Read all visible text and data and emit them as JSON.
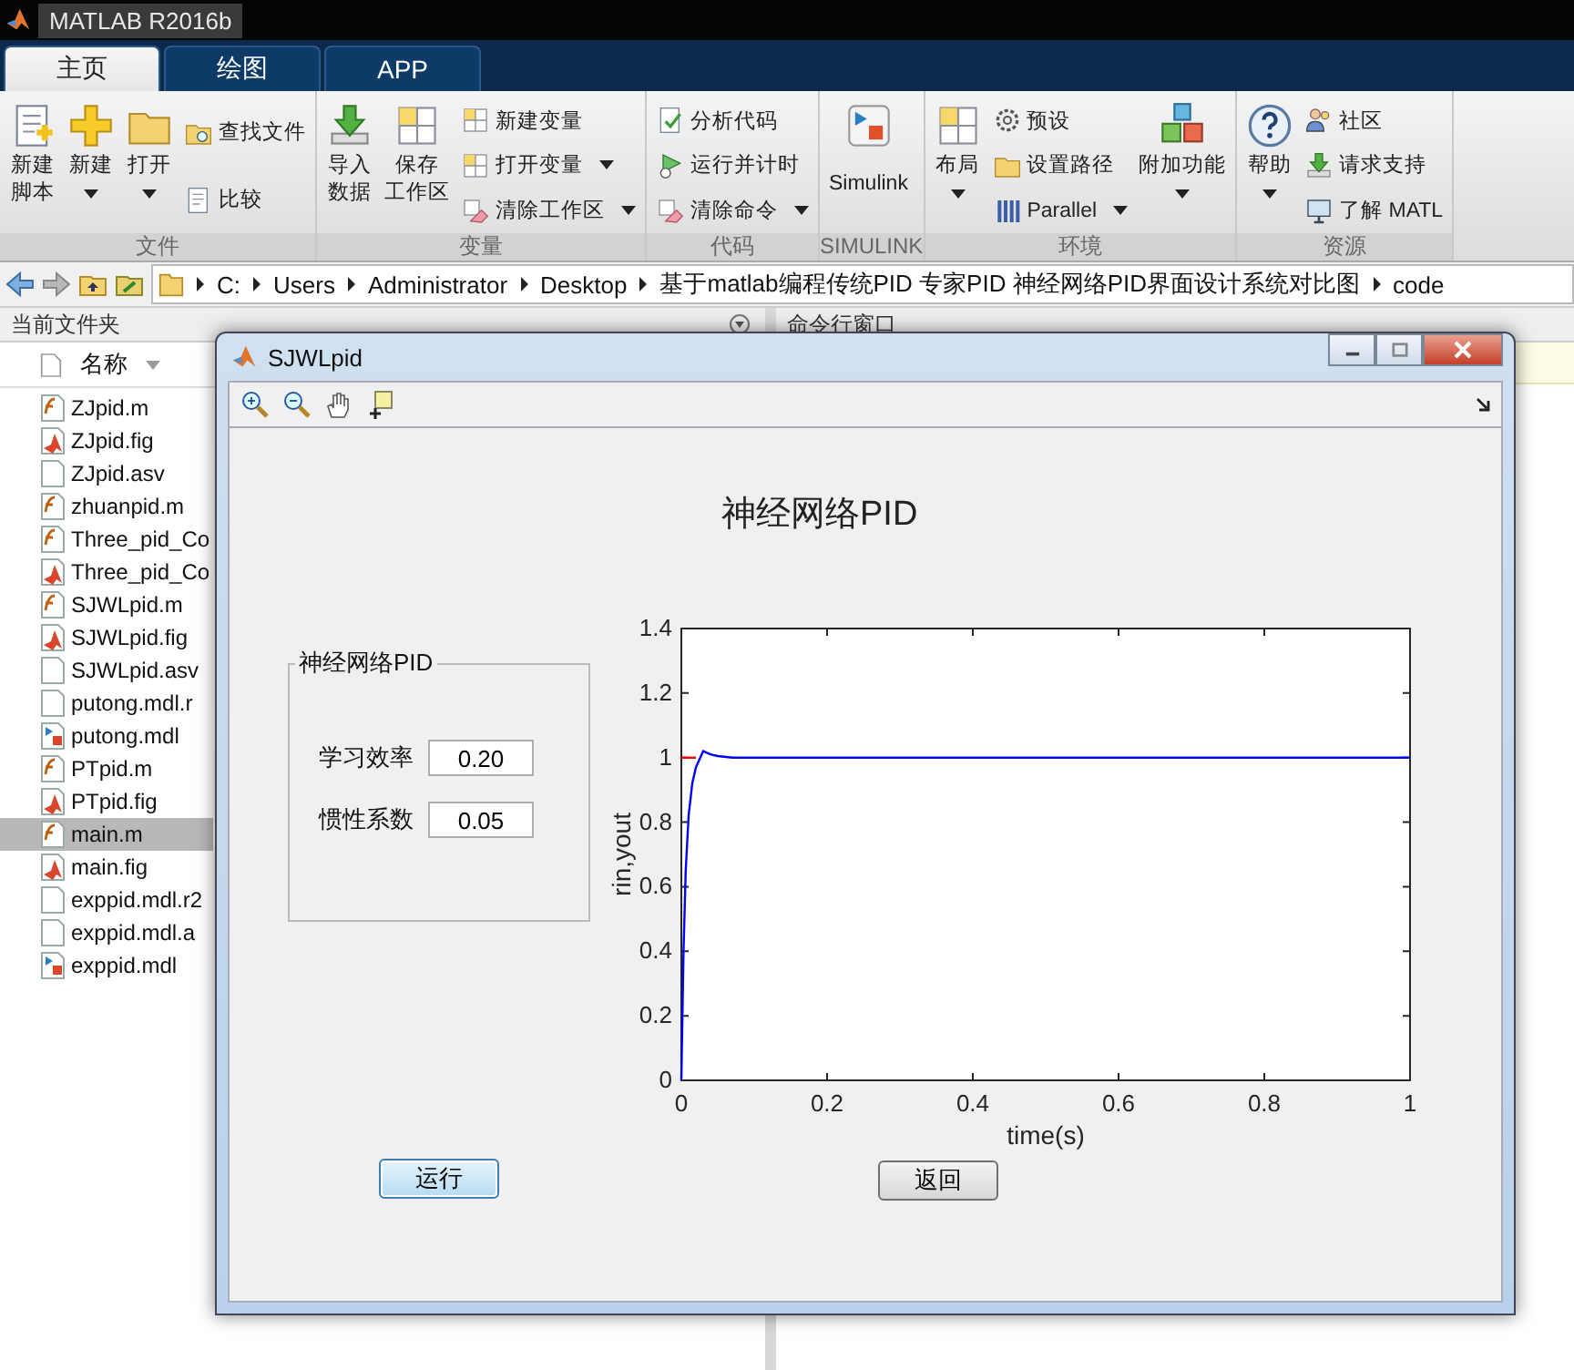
{
  "title_bar": {
    "title": "MATLAB R2016b"
  },
  "tabs": [
    {
      "label": "主页",
      "selected": true
    },
    {
      "label": "绘图",
      "selected": false
    },
    {
      "label": "APP",
      "selected": false
    }
  ],
  "ribbon": [
    {
      "label": "文件",
      "items": [
        {
          "kind": "large",
          "lines": [
            "新建",
            "脚本"
          ],
          "dropdown": false
        },
        {
          "kind": "large",
          "lines": [
            "新建"
          ],
          "dropdown": true
        },
        {
          "kind": "large",
          "lines": [
            "打开"
          ],
          "dropdown": true
        },
        {
          "kind": "stack",
          "items": [
            {
              "label": "查找文件",
              "dropdown": false
            },
            {
              "label": "比较",
              "dropdown": false
            }
          ]
        }
      ]
    },
    {
      "label": "变量",
      "items": [
        {
          "kind": "large",
          "lines": [
            "导入",
            "数据"
          ],
          "dropdown": false
        },
        {
          "kind": "large",
          "lines": [
            "保存",
            "工作区"
          ],
          "dropdown": false
        },
        {
          "kind": "stack",
          "items": [
            {
              "label": "新建变量",
              "dropdown": false
            },
            {
              "label": "打开变量",
              "dropdown": true
            },
            {
              "label": "清除工作区",
              "dropdown": true
            }
          ]
        }
      ]
    },
    {
      "label": "代码",
      "items": [
        {
          "kind": "stack",
          "items": [
            {
              "label": "分析代码",
              "dropdown": false
            },
            {
              "label": "运行并计时",
              "dropdown": false
            },
            {
              "label": "清除命令",
              "dropdown": true
            }
          ]
        }
      ]
    },
    {
      "label": "SIMULINK",
      "items": [
        {
          "kind": "large",
          "lines": [
            "Simulink"
          ],
          "dropdown": false
        }
      ]
    },
    {
      "label": "环境",
      "items": [
        {
          "kind": "large",
          "lines": [
            "布局"
          ],
          "dropdown": true
        },
        {
          "kind": "stack",
          "items": [
            {
              "label": "预设",
              "dropdown": false
            },
            {
              "label": "设置路径",
              "dropdown": false
            },
            {
              "label": "Parallel",
              "dropdown": true
            }
          ]
        },
        {
          "kind": "large",
          "lines": [
            "附加功能"
          ],
          "dropdown": true
        }
      ]
    },
    {
      "label": "资源",
      "items": [
        {
          "kind": "large",
          "lines": [
            "帮助"
          ],
          "dropdown": true
        },
        {
          "kind": "stack",
          "items": [
            {
              "label": "社区",
              "dropdown": false
            },
            {
              "label": "请求支持",
              "dropdown": false
            },
            {
              "label": "了解 MATL",
              "dropdown": false
            }
          ]
        }
      ]
    }
  ],
  "address_bar": {
    "path": [
      "C:",
      "Users",
      "Administrator",
      "Desktop",
      "基于matlab编程传统PID 专家PID 神经网络PID界面设计系统对比图",
      "code"
    ]
  },
  "current_folder": {
    "title": "当前文件夹",
    "column": "名称",
    "files": [
      {
        "name": "ZJpid.m",
        "kind": "m",
        "selected": false
      },
      {
        "name": "ZJpid.fig",
        "kind": "fig",
        "selected": false
      },
      {
        "name": "ZJpid.asv",
        "kind": "plain",
        "selected": false
      },
      {
        "name": "zhuanpid.m",
        "kind": "m",
        "selected": false
      },
      {
        "name": "Three_pid_Co",
        "kind": "m",
        "selected": false
      },
      {
        "name": "Three_pid_Co",
        "kind": "fig",
        "selected": false
      },
      {
        "name": "SJWLpid.m",
        "kind": "m",
        "selected": false
      },
      {
        "name": "SJWLpid.fig",
        "kind": "fig",
        "selected": false
      },
      {
        "name": "SJWLpid.asv",
        "kind": "plain",
        "selected": false
      },
      {
        "name": "putong.mdl.r",
        "kind": "plain",
        "selected": false
      },
      {
        "name": "putong.mdl",
        "kind": "mdl",
        "selected": false
      },
      {
        "name": "PTpid.m",
        "kind": "m",
        "selected": false
      },
      {
        "name": "PTpid.fig",
        "kind": "fig",
        "selected": false
      },
      {
        "name": "main.m",
        "kind": "m",
        "selected": true
      },
      {
        "name": "main.fig",
        "kind": "fig",
        "selected": false
      },
      {
        "name": "exppid.mdl.r2",
        "kind": "plain",
        "selected": false
      },
      {
        "name": "exppid.mdl.a",
        "kind": "plain",
        "selected": false
      },
      {
        "name": "exppid.mdl",
        "kind": "mdl",
        "selected": false
      }
    ]
  },
  "command_window": {
    "title": "命令行窗口"
  },
  "figure_window": {
    "title": "SJWLpid",
    "heading": "神经网络PID",
    "panel": {
      "title": "神经网络PID",
      "fields": [
        {
          "label": "学习效率",
          "value": "0.20"
        },
        {
          "label": "惯性系数",
          "value": "0.05"
        }
      ]
    },
    "buttons": [
      {
        "label": "运行",
        "focused": true
      },
      {
        "label": "返回",
        "focused": false
      }
    ],
    "chart_data": {
      "type": "line",
      "xlabel": "time(s)",
      "ylabel": "rin,yout",
      "x": [
        0,
        0.003,
        0.006,
        0.01,
        0.015,
        0.02,
        0.03,
        0.04,
        0.05,
        0.07,
        0.1,
        0.5,
        1
      ],
      "series": [
        {
          "color": "#ff0000",
          "values": [
            1,
            1,
            1,
            1,
            1,
            1,
            null,
            null,
            null,
            null,
            null,
            null,
            null
          ]
        },
        {
          "color": "#0000ff",
          "values": [
            0,
            0.4,
            0.65,
            0.82,
            0.92,
            0.97,
            1.02,
            1.01,
            1.005,
            1,
            1,
            1,
            1
          ]
        }
      ],
      "xlim": [
        0,
        1
      ],
      "ylim": [
        0,
        1.4
      ],
      "xticks": [
        0,
        0.2,
        0.4,
        0.6,
        0.8,
        1
      ],
      "yticks": [
        0,
        0.2,
        0.4,
        0.6,
        0.8,
        1,
        1.2,
        1.4
      ]
    }
  }
}
